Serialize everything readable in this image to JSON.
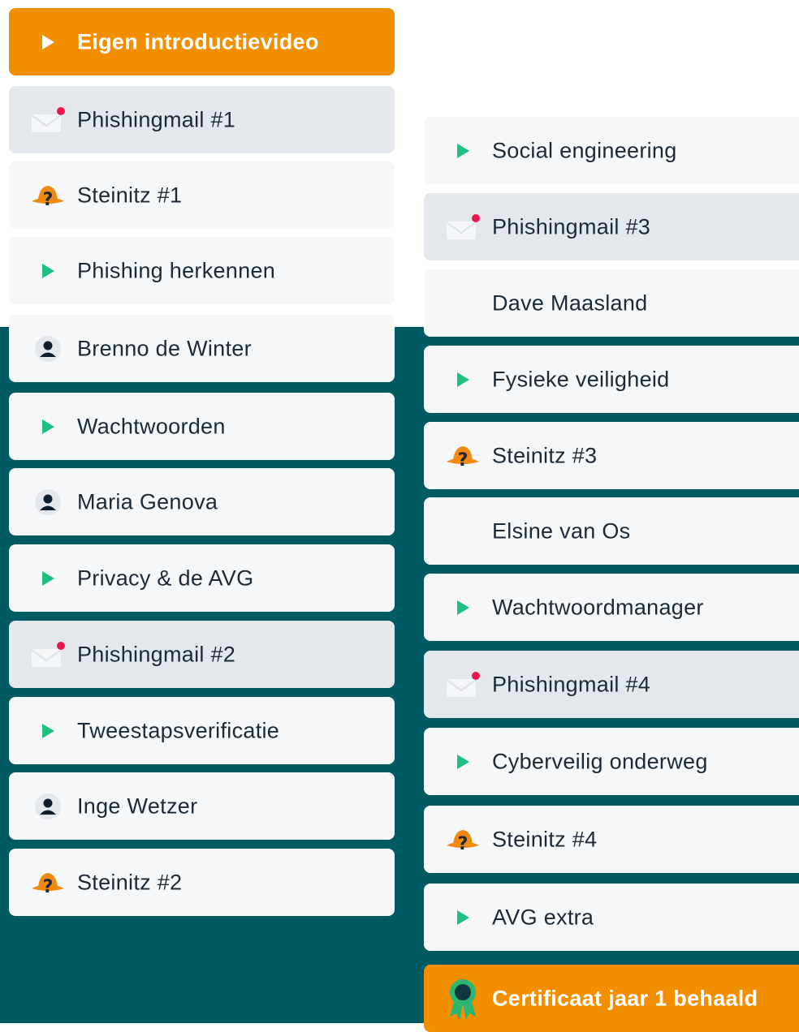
{
  "colors": {
    "teal": "#005a62",
    "orange": "#f18f01",
    "play_green": "#1fbf7f",
    "mail_dot": "#e8174f",
    "hat_orange": "#f08a10",
    "card_light": "#f5f7f9",
    "card_mail": "#e4e8ec"
  },
  "left_column": [
    {
      "label": "Eigen introductievideo",
      "icon": "play-icon",
      "variant": "orange"
    },
    {
      "label": "Phishingmail #1",
      "icon": "mail-icon",
      "variant": "mail"
    },
    {
      "label": "Steinitz #1",
      "icon": "detective-hat-icon",
      "variant": "light"
    },
    {
      "label": "Phishing herkennen",
      "icon": "play-icon",
      "variant": "light"
    },
    {
      "label": "Brenno de Winter",
      "icon": "person-icon",
      "variant": "light"
    },
    {
      "label": "Wachtwoorden",
      "icon": "play-icon",
      "variant": "light"
    },
    {
      "label": "Maria Genova",
      "icon": "person-icon",
      "variant": "light"
    },
    {
      "label": "Privacy & de AVG",
      "icon": "play-icon",
      "variant": "light"
    },
    {
      "label": "Phishingmail #2",
      "icon": "mail-icon",
      "variant": "mail"
    },
    {
      "label": "Tweestapsverificatie",
      "icon": "play-icon",
      "variant": "light"
    },
    {
      "label": "Inge Wetzer",
      "icon": "person-icon",
      "variant": "light"
    },
    {
      "label": "Steinitz #2",
      "icon": "detective-hat-icon",
      "variant": "light"
    }
  ],
  "right_column": [
    {
      "label": "Social engineering",
      "icon": "play-icon",
      "variant": "light"
    },
    {
      "label": "Phishingmail #3",
      "icon": "mail-icon",
      "variant": "mail"
    },
    {
      "label": "Dave Maasland",
      "icon": "",
      "variant": "light"
    },
    {
      "label": "Fysieke veiligheid",
      "icon": "play-icon",
      "variant": "light"
    },
    {
      "label": "Steinitz #3",
      "icon": "detective-hat-icon",
      "variant": "light"
    },
    {
      "label": "Elsine van Os",
      "icon": "",
      "variant": "light"
    },
    {
      "label": "Wachtwoordmanager",
      "icon": "play-icon",
      "variant": "light"
    },
    {
      "label": "Phishingmail #4",
      "icon": "mail-icon",
      "variant": "mail"
    },
    {
      "label": "Cyberveilig onderweg",
      "icon": "play-icon",
      "variant": "light"
    },
    {
      "label": "Steinitz #4",
      "icon": "detective-hat-icon",
      "variant": "light"
    },
    {
      "label": "AVG extra",
      "icon": "play-icon",
      "variant": "light"
    },
    {
      "label": "Certificaat jaar 1 behaald",
      "icon": "award-ribbon-icon",
      "variant": "orange"
    }
  ]
}
